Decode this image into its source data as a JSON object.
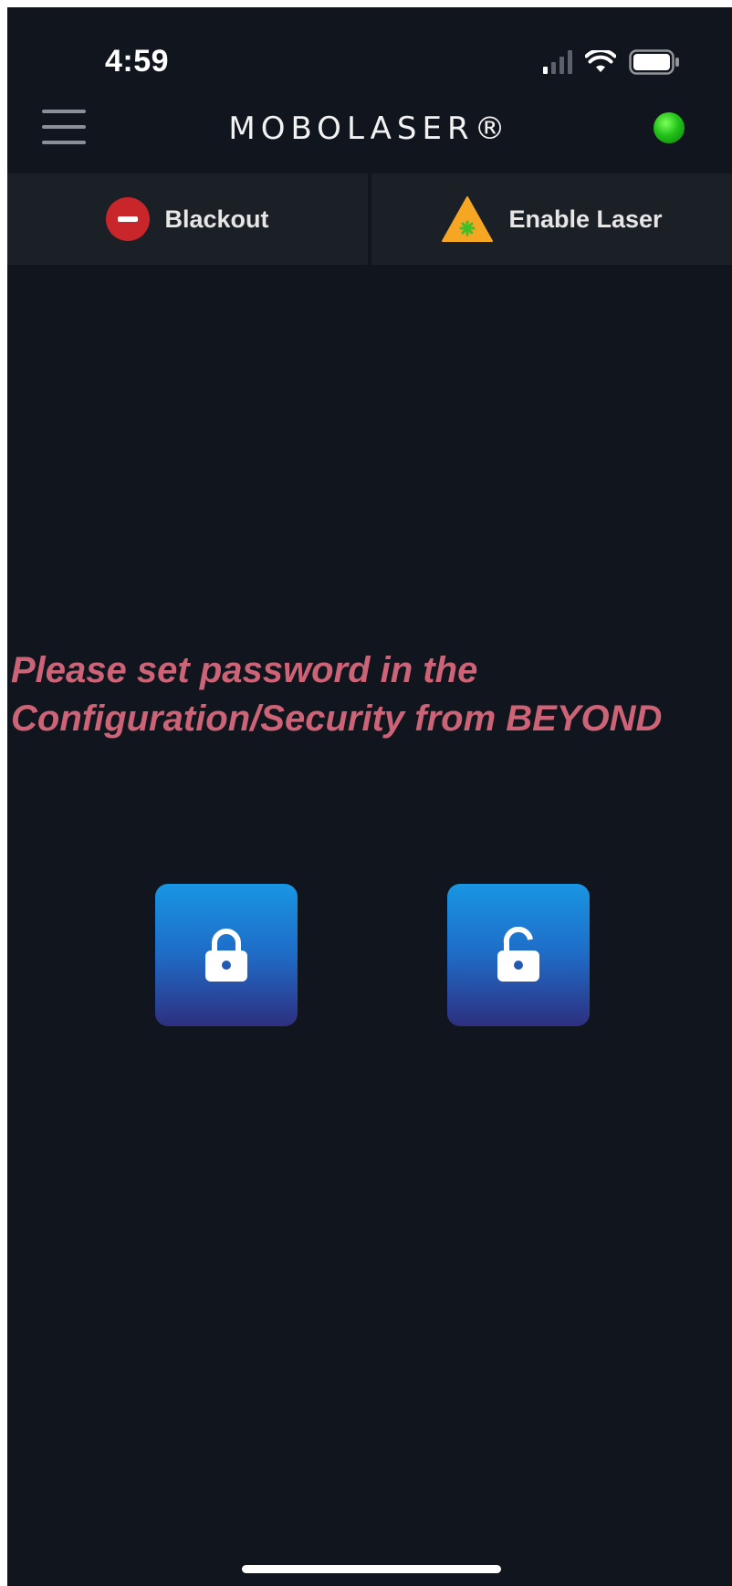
{
  "status_bar": {
    "time": "4:59"
  },
  "header": {
    "title": "MOBOLASER®",
    "connection_color": "#22c21a"
  },
  "actions": {
    "blackout_label": "Blackout",
    "enable_laser_label": "Enable Laser"
  },
  "main": {
    "message_line1": "Please set password in the",
    "message_line2": "Configuration/Security from BEYOND",
    "message_color": "#cc6377",
    "lock_icon": "lock-closed-icon",
    "unlock_icon": "lock-open-icon"
  }
}
